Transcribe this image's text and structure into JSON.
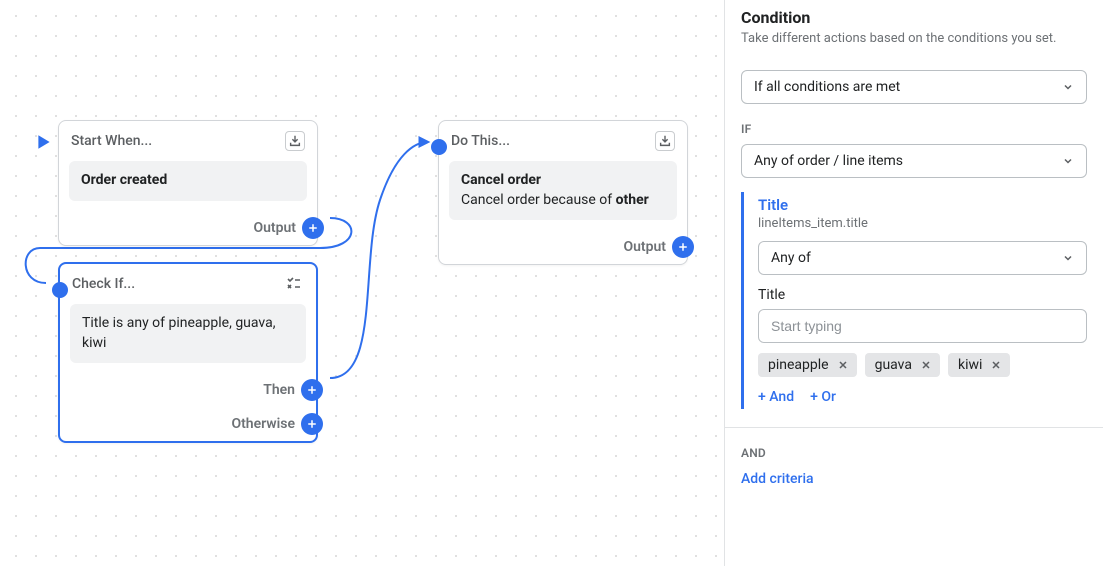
{
  "canvas": {
    "nodes": {
      "start": {
        "header": "Start When...",
        "body": "Order created",
        "output_label": "Output"
      },
      "check": {
        "header": "Check If...",
        "body": "Title is any of pineapple, guava, kiwi",
        "then_label": "Then",
        "otherwise_label": "Otherwise"
      },
      "action": {
        "header": "Do This...",
        "body_title": "Cancel order",
        "body_sub_prefix": "Cancel order because of ",
        "body_sub_bold": "other",
        "output_label": "Output"
      }
    }
  },
  "panel": {
    "title": "Condition",
    "subtitle": "Take different actions based on the conditions you set.",
    "match_mode": "If all conditions are met",
    "if_label": "IF",
    "scope": "Any of order / line items",
    "criteria": {
      "title": "Title",
      "path": "lineItems_item.title",
      "operator": "Any of",
      "value_label": "Title",
      "value_placeholder": "Start typing",
      "tags": [
        "pineapple",
        "guava",
        "kiwi"
      ],
      "add_and": "+ And",
      "add_or": "+ Or"
    },
    "and_label": "AND",
    "add_criteria": "Add criteria"
  }
}
